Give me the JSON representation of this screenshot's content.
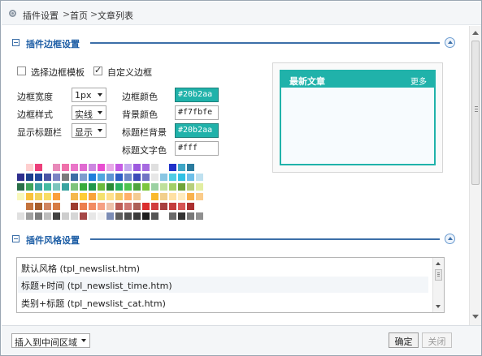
{
  "breadcrumb": {
    "items": [
      "插件设置",
      "首页",
      "文章列表"
    ],
    "separator": ">"
  },
  "border_section": {
    "title": "插件边框设置",
    "choose_template_label": "选择边框模板",
    "custom_border_label": "自定义边框",
    "choose_template_checked": false,
    "custom_border_checked": true,
    "fields": {
      "border_width_label": "边框宽度",
      "border_width_value": "1px",
      "border_style_label": "边框样式",
      "border_style_value": "实线",
      "show_title_label": "显示标题栏",
      "show_title_value": "显示",
      "border_color_label": "边框颜色",
      "border_color_value": "#20b2aa",
      "bg_color_label": "背景颜色",
      "bg_color_value": "#f7fbfe",
      "title_bg_label": "标题栏背景",
      "title_bg_value": "#20b2aa",
      "title_text_label": "标题文字色",
      "title_text_value": "#fff"
    },
    "preview": {
      "title": "最新文章",
      "more": "更多"
    },
    "palette": [
      [
        "#ffffff",
        "#fecfcf",
        "#ec3f7a",
        "#ffffff",
        "#e889b9",
        "#ef70aa",
        "#ea75c8",
        "#e06ad1",
        "#cc87e0",
        "#e94dd1",
        "#e8a9e8",
        "#c55be4",
        "#c4a8ee",
        "#9d5adf",
        "#a66ae0",
        "#dfdfdf",
        "#ffffff",
        "#1f31c9",
        "#3ea6c6",
        "#2a7b9e",
        "#ffffff"
      ],
      [
        "#2f2f8e",
        "#1b3f8c",
        "#21479b",
        "#4a55a5",
        "#7b84c4",
        "#7b7b7b",
        "#3d6ea5",
        "#7e9cce",
        "#1f7fdc",
        "#4fa6df",
        "#5d95d4",
        "#2e5ec6",
        "#6b86c7",
        "#3c4ab8",
        "#7174c4",
        "#e7e7e7",
        "#89c6e3",
        "#4fcce4",
        "#2fc1e4",
        "#6cbfe9",
        "#bfe1f0"
      ],
      [
        "#2a6f49",
        "#3ea45a",
        "#3aa1a2",
        "#45bba2",
        "#7cc5bd",
        "#3aa4a0",
        "#7ec47b",
        "#3bac3c",
        "#21974c",
        "#6bbb3d",
        "#2a8b36",
        "#2ab25e",
        "#4dc44f",
        "#4ea43e",
        "#7cc73d",
        "#9bd1a2",
        "#bfe09b",
        "#a2cf67",
        "#6fa43a",
        "#b6cf7b",
        "#e2eea2"
      ],
      [
        "#f8f8bb",
        "#f9c23b",
        "#f3d35c",
        "#f8dd66",
        "#fb9f3c",
        "#ffffff",
        "#f5b84d",
        "#ffcc35",
        "#f9a33a",
        "#f4e16e",
        "#ffe08b",
        "#f3c865",
        "#ffb06a",
        "#f4cb92",
        "#ffffff",
        "#f9b92c",
        "#f2cf8c",
        "#ffe0a3",
        "#ffebbe",
        "#f9b24d",
        "#fbcc8a"
      ],
      [
        "#ffffff",
        "#c4733c",
        "#a75e2b",
        "#d0845f",
        "#d77b43",
        "#ffffff",
        "#9e3c2f",
        "#ec7e4c",
        "#f28b62",
        "#f6a083",
        "#eec1aa",
        "#bd5c57",
        "#ce7672",
        "#ad5f57",
        "#db2e2e",
        "#d13e3e",
        "#a83f3f",
        "#c43c3c",
        "#d65454",
        "#ab2f2f",
        "#ffffff"
      ],
      [
        "#e0e0e0",
        "#9f9f9f",
        "#7d7d7d",
        "#bdbdbd",
        "#414141",
        "#cdcdcd",
        "#d6d6d6",
        "#a54747",
        "#e7e7e7",
        "#f2f2f2",
        "#7b8cb5",
        "#5d5d5d",
        "#4d4d4d",
        "#3a3a3a",
        "#1f1f1f",
        "#555555",
        "#ffffff",
        "#6a6a6a",
        "#333333",
        "#787878",
        "#909090"
      ]
    ]
  },
  "style_section": {
    "title": "插件风格设置",
    "items": [
      "默认风格 (tpl_newslist.htm)",
      "标题+时间 (tpl_newslist_time.htm)",
      "类别+标题 (tpl_newslist_cat.htm)"
    ],
    "selected_index": 1
  },
  "footer": {
    "insert_region": "插入到中间区域",
    "confirm": "确定",
    "close": "关闭"
  }
}
